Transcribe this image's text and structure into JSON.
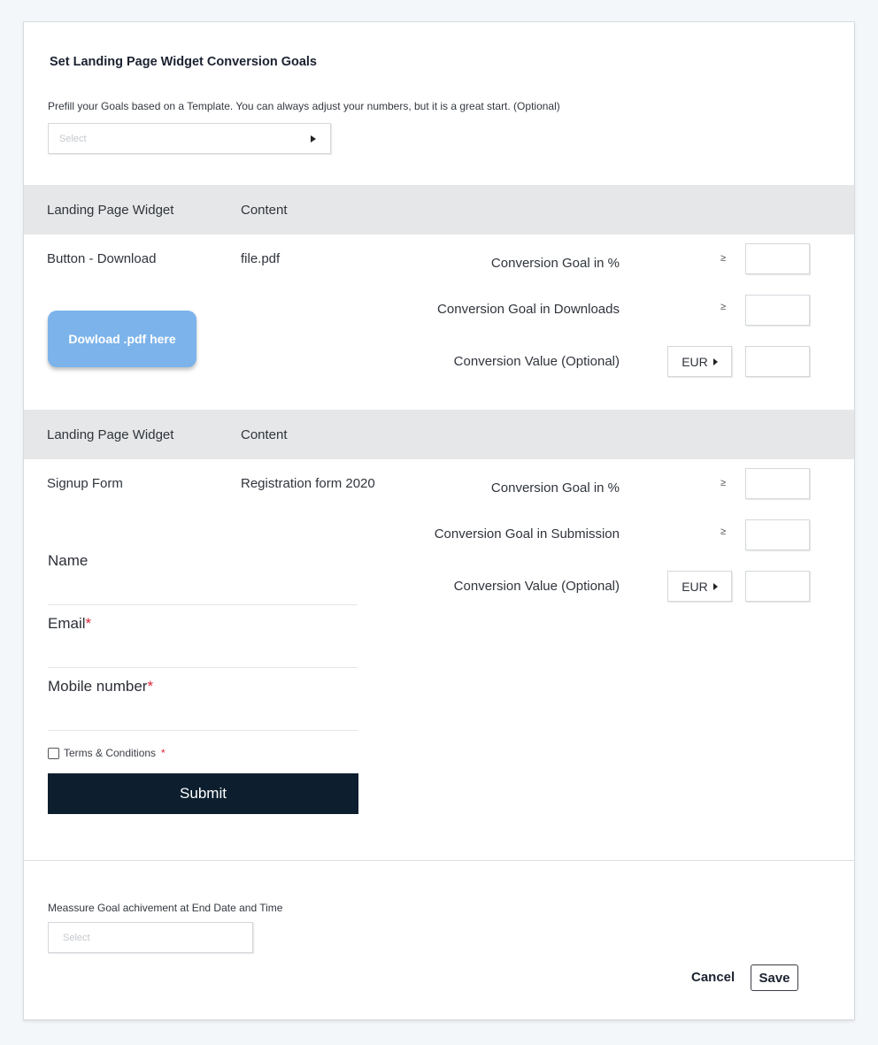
{
  "header": {
    "title": "Set Landing Page Widget Conversion Goals",
    "prefill_label": "Prefill your Goals based on a Template. You can always adjust your numbers, but it is a great start. (Optional)",
    "template_select_placeholder": "Select"
  },
  "sections": [
    {
      "head": {
        "col1": "Landing Page Widget",
        "col2": "Content"
      },
      "widget": "Button - Download",
      "content": "file.pdf",
      "preview_button_label": "Dowload .pdf here",
      "goals": [
        {
          "label": "Conversion Goal in %",
          "operator": "≥",
          "value": ""
        },
        {
          "label": "Conversion Goal in Downloads",
          "operator": "≥",
          "value": ""
        },
        {
          "label": "Conversion Value (Optional)",
          "currency": "EUR",
          "value": ""
        }
      ]
    },
    {
      "head": {
        "col1": "Landing Page Widget",
        "col2": "Content"
      },
      "widget": "Signup Form",
      "content": "Registration form 2020",
      "form_preview": {
        "fields": [
          {
            "label": "Name",
            "required": ""
          },
          {
            "label": "Email",
            "required": "*"
          },
          {
            "label": "Mobile number",
            "required": "*"
          }
        ],
        "terms_label": "Terms & Conditions",
        "terms_required": "*",
        "submit_label": "Submit"
      },
      "goals": [
        {
          "label": "Conversion Goal in %",
          "operator": "≥",
          "value": ""
        },
        {
          "label": "Conversion Goal in Submission",
          "operator": "≥",
          "value": ""
        },
        {
          "label": "Conversion Value (Optional)",
          "currency": "EUR",
          "value": ""
        }
      ]
    }
  ],
  "footer": {
    "measure_label": "Meassure Goal achivement at End Date and Time",
    "measure_select_placeholder": "Select",
    "cancel_label": "Cancel",
    "save_label": "Save"
  },
  "colors": {
    "preview_button": "#7cb3ea",
    "submit_button": "#0d1e2e",
    "required_mark": "#e0243a",
    "table_header_bg": "#e6e7e8"
  }
}
